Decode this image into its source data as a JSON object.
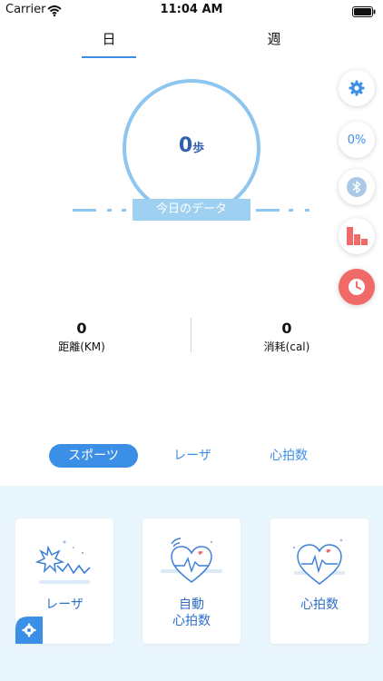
{
  "status_bar": {
    "carrier": "Carrier",
    "time": "11:04 AM"
  },
  "tabs": {
    "day": "日",
    "week": "週"
  },
  "ring": {
    "steps_value": "0",
    "steps_unit": "歩",
    "today_label": "今日のデータ"
  },
  "side_buttons": {
    "percent": "0%"
  },
  "stats": {
    "distance": {
      "value": "0",
      "label": "距離(KM)"
    },
    "calories": {
      "value": "0",
      "label": "消耗(cal)"
    }
  },
  "modes": {
    "sports": "スポーツ",
    "laser": "レーザ",
    "heart_rate": "心拍数"
  },
  "cards": {
    "laser": "レーザ",
    "auto_hr_line1": "自動",
    "auto_hr_line2": "心拍数",
    "heart_rate": "心拍数"
  },
  "colors": {
    "accent": "#3c8fe6",
    "ring": "#8fc6ef",
    "alarm": "#f16a6a",
    "bottom_bg": "#eaf6fd"
  }
}
